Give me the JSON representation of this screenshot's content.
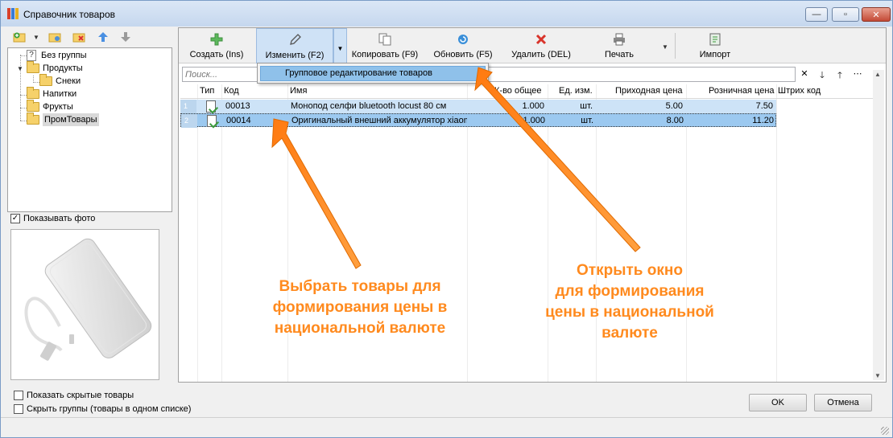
{
  "window": {
    "title": "Справочник товаров",
    "min_label": "—",
    "max_label": "▫",
    "close_label": "✕"
  },
  "tree": {
    "items": [
      "Без группы",
      "Продукты",
      "Снеки",
      "Напитки",
      "Фрукты",
      "ПромТовары"
    ],
    "selected": "ПромТовары",
    "question_mark": "?"
  },
  "photo": {
    "show_photo_label": "Показывать фото",
    "checked": true,
    "check_mark": "✓"
  },
  "toolbar": {
    "create": "Создать (Ins)",
    "edit": "Изменить (F2)",
    "copy": "Копировать (F9)",
    "refresh": "Обновить (F5)",
    "delete": "Удалить (DEL)",
    "print": "Печать",
    "import": "Импорт"
  },
  "dropdown": {
    "item": "Групповое редактирование товаров"
  },
  "search": {
    "placeholder": "Поиск...",
    "clear_icon": "✕",
    "down_icon": "🡓",
    "up_icon": "🡑",
    "more_icon": "⋯"
  },
  "grid": {
    "columns": [
      "Тип",
      "Код",
      "Имя",
      "К-во общее",
      "Ед. изм.",
      "Приходная цена",
      "Розничная цена",
      "Штрих код"
    ],
    "rows": [
      {
        "num": "1",
        "code": "00013",
        "name": "Монопод селфи bluetooth locust 80 см",
        "qty": "1.000",
        "unit": "шт.",
        "in_price": "5.00",
        "retail_price": "7.50",
        "barcode": ""
      },
      {
        "num": "2",
        "code": "00014",
        "name": "Оригинальный внешний аккумулятор xiaomi",
        "qty": "1.000",
        "unit": "шт.",
        "in_price": "8.00",
        "retail_price": "11.20",
        "barcode": ""
      }
    ]
  },
  "options": {
    "show_hidden": "Показать скрытые товары",
    "hide_groups": "Скрыть группы (товары в одном списке)"
  },
  "buttons": {
    "ok": "OK",
    "cancel": "Отмена"
  },
  "annotations": {
    "left": [
      "Выбрать товары для",
      "формирования цены в",
      "национальной валюте"
    ],
    "right": [
      "Открыть окно",
      "для формирования",
      "цены в национальной",
      "валюте"
    ],
    "color": "#ff8a1e"
  }
}
